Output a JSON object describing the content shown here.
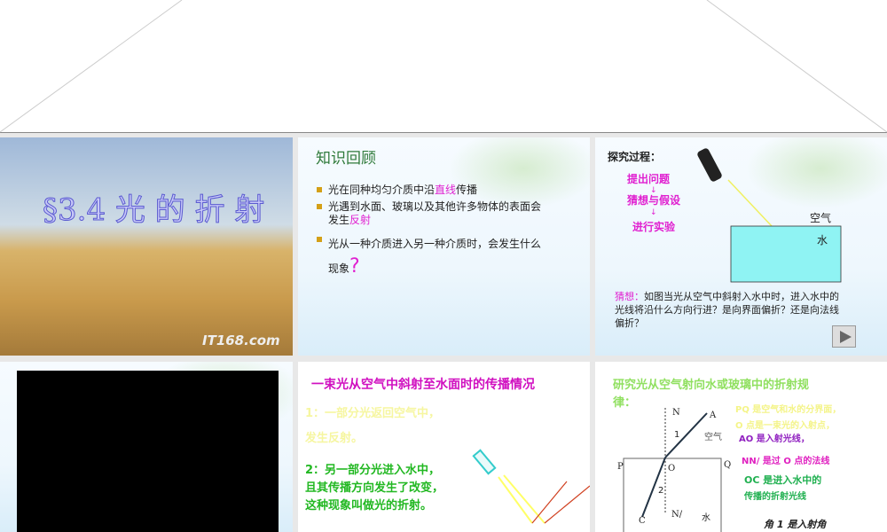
{
  "slide1": {
    "title": "§3.4 光 的 折 射",
    "watermark": "IT168.com"
  },
  "slide2": {
    "heading": "知识回顾",
    "b1a": "光在同种均匀介质中沿",
    "b1b": "直线",
    "b1c": "传播",
    "b2a": "光遇到水面、玻璃以及其他许多物体的表面会",
    "b2b": "发生",
    "b2c": "反射",
    "b3a": "光从一种介质进入另一种介质时，会发生什么",
    "b3b": "现象",
    "b3c": "?"
  },
  "slide3": {
    "heading": "探究过程：",
    "steps": [
      "提出问题",
      "↓",
      "猜想与假设",
      "↓",
      "进行实验"
    ],
    "air": "空气",
    "water": "水",
    "guess_label": "猜想：",
    "guess1": "如图当光从空气中斜射入水中时，进入水中的",
    "guess2": "光线将沿什么方向行进？是向界面偏折？还是向法线",
    "guess3": "偏折？"
  },
  "slide5": {
    "title": "一束光从空气中斜射至水面时的传播情况",
    "p1a": "1：一部分光返回空气中，",
    "p1b": "发生反射。",
    "p2a": "2：另一部分光进入水中，",
    "p2b": "且其传播方向发生了改变，",
    "p2c": "这种现象叫做光的折射。"
  },
  "slide6": {
    "title1": "研究光从空气射向水或玻璃中的折射规",
    "title2": "律：",
    "N": "N",
    "A": "A",
    "one": "1",
    "air": "空气",
    "P": "P",
    "O": "O",
    "Q": "Q",
    "two": "2",
    "C": "C",
    "N2": "N/",
    "water": "水",
    "r1": "PQ 是空气和水的分界面，",
    "r2": "O 点是一束光的入射点，",
    "r3": "AO 是入射光线，",
    "r4": "NN/ 是过 O 点的法线",
    "r5": "OC 是进入水中的",
    "r6": "传播的折射光线",
    "r7": "角 1 是入射角"
  }
}
